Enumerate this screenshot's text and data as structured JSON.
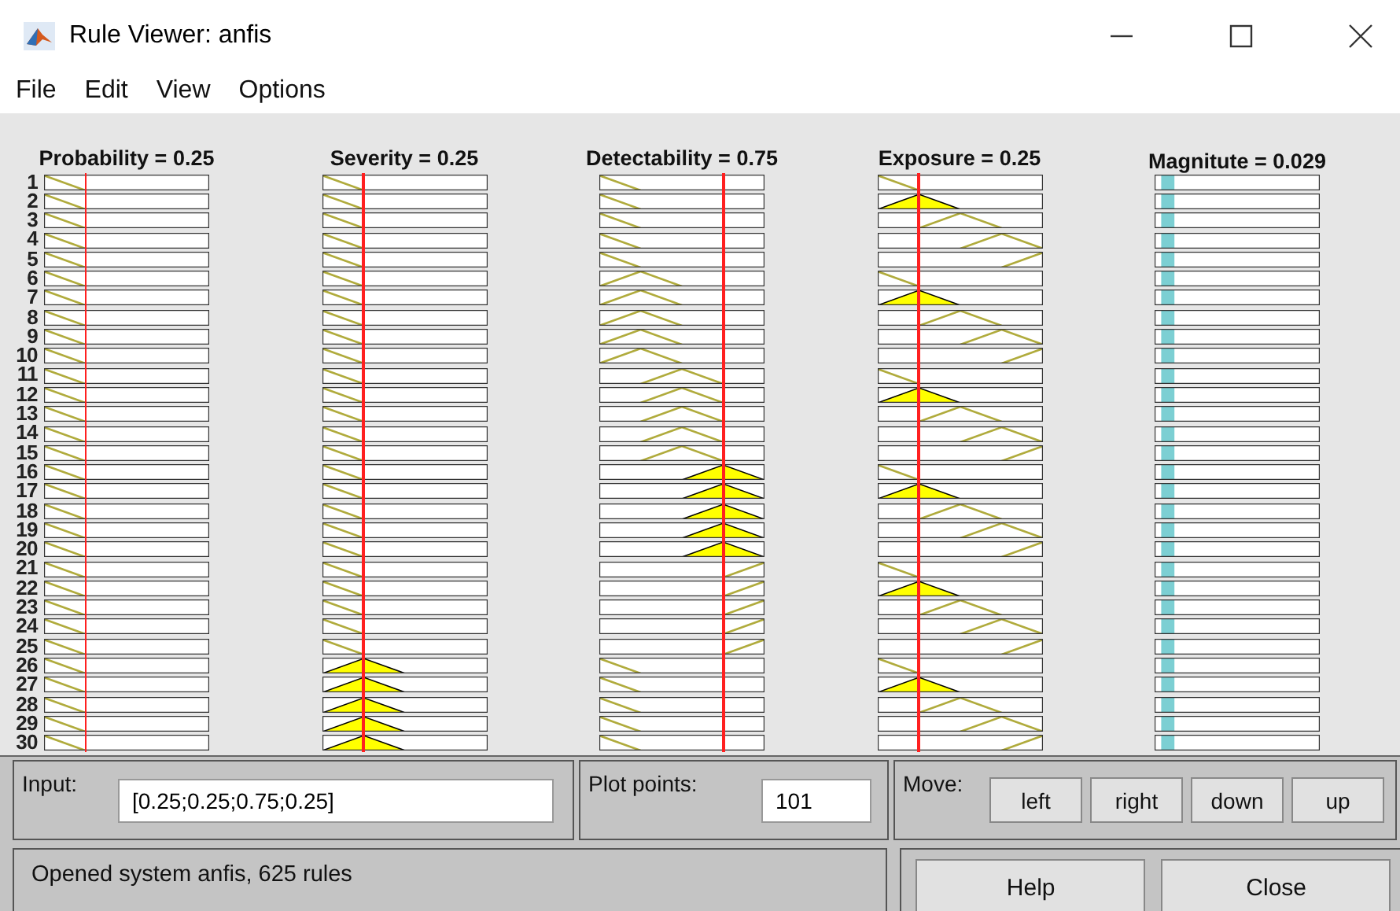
{
  "window": {
    "title": "Rule Viewer: anfis"
  },
  "menu": [
    "File",
    "Edit",
    "View",
    "Options"
  ],
  "variables": [
    {
      "label": "Probability = 0.25"
    },
    {
      "label": "Severity = 0.25"
    },
    {
      "label": "Detectability = 0.75"
    },
    {
      "label": "Exposure = 0.25"
    }
  ],
  "output": {
    "label": "Magnitute = 0.029"
  },
  "rules": [
    {
      "number": "1",
      "cells": [
        {
          "kind": "mf1",
          "fired": false
        },
        {
          "kind": "mf1",
          "fired": false
        },
        {
          "kind": "mf1",
          "fired": false
        },
        {
          "kind": "mf1",
          "fired": false
        }
      ]
    },
    {
      "number": "2",
      "cells": [
        {
          "kind": "mf1",
          "fired": false
        },
        {
          "kind": "mf1",
          "fired": false
        },
        {
          "kind": "mf1",
          "fired": false
        },
        {
          "kind": "mf2",
          "fired": true
        }
      ]
    },
    {
      "number": "3",
      "cells": [
        {
          "kind": "mf1",
          "fired": false
        },
        {
          "kind": "mf1",
          "fired": false
        },
        {
          "kind": "mf1",
          "fired": false
        },
        {
          "kind": "mf3",
          "fired": false
        }
      ]
    },
    {
      "number": "4",
      "cells": [
        {
          "kind": "mf1",
          "fired": false
        },
        {
          "kind": "mf1",
          "fired": false
        },
        {
          "kind": "mf1",
          "fired": false
        },
        {
          "kind": "mf4",
          "fired": false
        }
      ]
    },
    {
      "number": "5",
      "cells": [
        {
          "kind": "mf1",
          "fired": false
        },
        {
          "kind": "mf1",
          "fired": false
        },
        {
          "kind": "mf1",
          "fired": false
        },
        {
          "kind": "mf5",
          "fired": false
        }
      ]
    },
    {
      "number": "6",
      "cells": [
        {
          "kind": "mf1",
          "fired": false
        },
        {
          "kind": "mf1",
          "fired": false
        },
        {
          "kind": "mf2",
          "fired": false
        },
        {
          "kind": "mf1",
          "fired": false
        }
      ]
    },
    {
      "number": "7",
      "cells": [
        {
          "kind": "mf1",
          "fired": false
        },
        {
          "kind": "mf1",
          "fired": false
        },
        {
          "kind": "mf2",
          "fired": false
        },
        {
          "kind": "mf2",
          "fired": true
        }
      ]
    },
    {
      "number": "8",
      "cells": [
        {
          "kind": "mf1",
          "fired": false
        },
        {
          "kind": "mf1",
          "fired": false
        },
        {
          "kind": "mf2",
          "fired": false
        },
        {
          "kind": "mf3",
          "fired": false
        }
      ]
    },
    {
      "number": "9",
      "cells": [
        {
          "kind": "mf1",
          "fired": false
        },
        {
          "kind": "mf1",
          "fired": false
        },
        {
          "kind": "mf2",
          "fired": false
        },
        {
          "kind": "mf4",
          "fired": false
        }
      ]
    },
    {
      "number": "10",
      "cells": [
        {
          "kind": "mf1",
          "fired": false
        },
        {
          "kind": "mf1",
          "fired": false
        },
        {
          "kind": "mf2",
          "fired": false
        },
        {
          "kind": "mf5",
          "fired": false
        }
      ]
    },
    {
      "number": "11",
      "cells": [
        {
          "kind": "mf1",
          "fired": false
        },
        {
          "kind": "mf1",
          "fired": false
        },
        {
          "kind": "mf3",
          "fired": false
        },
        {
          "kind": "mf1",
          "fired": false
        }
      ]
    },
    {
      "number": "12",
      "cells": [
        {
          "kind": "mf1",
          "fired": false
        },
        {
          "kind": "mf1",
          "fired": false
        },
        {
          "kind": "mf3",
          "fired": false
        },
        {
          "kind": "mf2",
          "fired": true
        }
      ]
    },
    {
      "number": "13",
      "cells": [
        {
          "kind": "mf1",
          "fired": false
        },
        {
          "kind": "mf1",
          "fired": false
        },
        {
          "kind": "mf3",
          "fired": false
        },
        {
          "kind": "mf3",
          "fired": false
        }
      ]
    },
    {
      "number": "14",
      "cells": [
        {
          "kind": "mf1",
          "fired": false
        },
        {
          "kind": "mf1",
          "fired": false
        },
        {
          "kind": "mf3",
          "fired": false
        },
        {
          "kind": "mf4",
          "fired": false
        }
      ]
    },
    {
      "number": "15",
      "cells": [
        {
          "kind": "mf1",
          "fired": false
        },
        {
          "kind": "mf1",
          "fired": false
        },
        {
          "kind": "mf3",
          "fired": false
        },
        {
          "kind": "mf5",
          "fired": false
        }
      ]
    },
    {
      "number": "16",
      "cells": [
        {
          "kind": "mf1",
          "fired": false
        },
        {
          "kind": "mf1",
          "fired": false
        },
        {
          "kind": "mf4",
          "fired": true
        },
        {
          "kind": "mf1",
          "fired": false
        }
      ]
    },
    {
      "number": "17",
      "cells": [
        {
          "kind": "mf1",
          "fired": false
        },
        {
          "kind": "mf1",
          "fired": false
        },
        {
          "kind": "mf4",
          "fired": true
        },
        {
          "kind": "mf2",
          "fired": true
        }
      ]
    },
    {
      "number": "18",
      "cells": [
        {
          "kind": "mf1",
          "fired": false
        },
        {
          "kind": "mf1",
          "fired": false
        },
        {
          "kind": "mf4",
          "fired": true
        },
        {
          "kind": "mf3",
          "fired": false
        }
      ]
    },
    {
      "number": "19",
      "cells": [
        {
          "kind": "mf1",
          "fired": false
        },
        {
          "kind": "mf1",
          "fired": false
        },
        {
          "kind": "mf4",
          "fired": true
        },
        {
          "kind": "mf4",
          "fired": false
        }
      ]
    },
    {
      "number": "20",
      "cells": [
        {
          "kind": "mf1",
          "fired": false
        },
        {
          "kind": "mf1",
          "fired": false
        },
        {
          "kind": "mf4",
          "fired": true
        },
        {
          "kind": "mf5",
          "fired": false
        }
      ]
    },
    {
      "number": "21",
      "cells": [
        {
          "kind": "mf1",
          "fired": false
        },
        {
          "kind": "mf1",
          "fired": false
        },
        {
          "kind": "mf5",
          "fired": false
        },
        {
          "kind": "mf1",
          "fired": false
        }
      ]
    },
    {
      "number": "22",
      "cells": [
        {
          "kind": "mf1",
          "fired": false
        },
        {
          "kind": "mf1",
          "fired": false
        },
        {
          "kind": "mf5",
          "fired": false
        },
        {
          "kind": "mf2",
          "fired": true
        }
      ]
    },
    {
      "number": "23",
      "cells": [
        {
          "kind": "mf1",
          "fired": false
        },
        {
          "kind": "mf1",
          "fired": false
        },
        {
          "kind": "mf5",
          "fired": false
        },
        {
          "kind": "mf3",
          "fired": false
        }
      ]
    },
    {
      "number": "24",
      "cells": [
        {
          "kind": "mf1",
          "fired": false
        },
        {
          "kind": "mf1",
          "fired": false
        },
        {
          "kind": "mf5",
          "fired": false
        },
        {
          "kind": "mf4",
          "fired": false
        }
      ]
    },
    {
      "number": "25",
      "cells": [
        {
          "kind": "mf1",
          "fired": false
        },
        {
          "kind": "mf1",
          "fired": false
        },
        {
          "kind": "mf5",
          "fired": false
        },
        {
          "kind": "mf5",
          "fired": false
        }
      ]
    },
    {
      "number": "26",
      "cells": [
        {
          "kind": "mf1",
          "fired": false
        },
        {
          "kind": "mf2",
          "fired": true
        },
        {
          "kind": "mf1",
          "fired": false
        },
        {
          "kind": "mf1",
          "fired": false
        }
      ]
    },
    {
      "number": "27",
      "cells": [
        {
          "kind": "mf1",
          "fired": false
        },
        {
          "kind": "mf2",
          "fired": true
        },
        {
          "kind": "mf1",
          "fired": false
        },
        {
          "kind": "mf2",
          "fired": true
        }
      ]
    },
    {
      "number": "28",
      "cells": [
        {
          "kind": "mf1",
          "fired": false
        },
        {
          "kind": "mf2",
          "fired": true
        },
        {
          "kind": "mf1",
          "fired": false
        },
        {
          "kind": "mf3",
          "fired": false
        }
      ]
    },
    {
      "number": "29",
      "cells": [
        {
          "kind": "mf1",
          "fired": false
        },
        {
          "kind": "mf2",
          "fired": true
        },
        {
          "kind": "mf1",
          "fired": false
        },
        {
          "kind": "mf4",
          "fired": false
        }
      ]
    },
    {
      "number": "30",
      "cells": [
        {
          "kind": "mf1",
          "fired": false
        },
        {
          "kind": "mf2",
          "fired": true
        },
        {
          "kind": "mf1",
          "fired": false
        },
        {
          "kind": "mf5",
          "fired": false
        }
      ]
    }
  ],
  "input": {
    "label": "Input:",
    "value": "[0.25;0.25;0.75;0.25]"
  },
  "plot_points": {
    "label": "Plot points:",
    "value": "101"
  },
  "move": {
    "label": "Move:",
    "buttons": [
      "left",
      "right",
      "down",
      "up"
    ]
  },
  "status": "Opened system anfis, 625 rules",
  "buttons": [
    "Help",
    "Close"
  ]
}
